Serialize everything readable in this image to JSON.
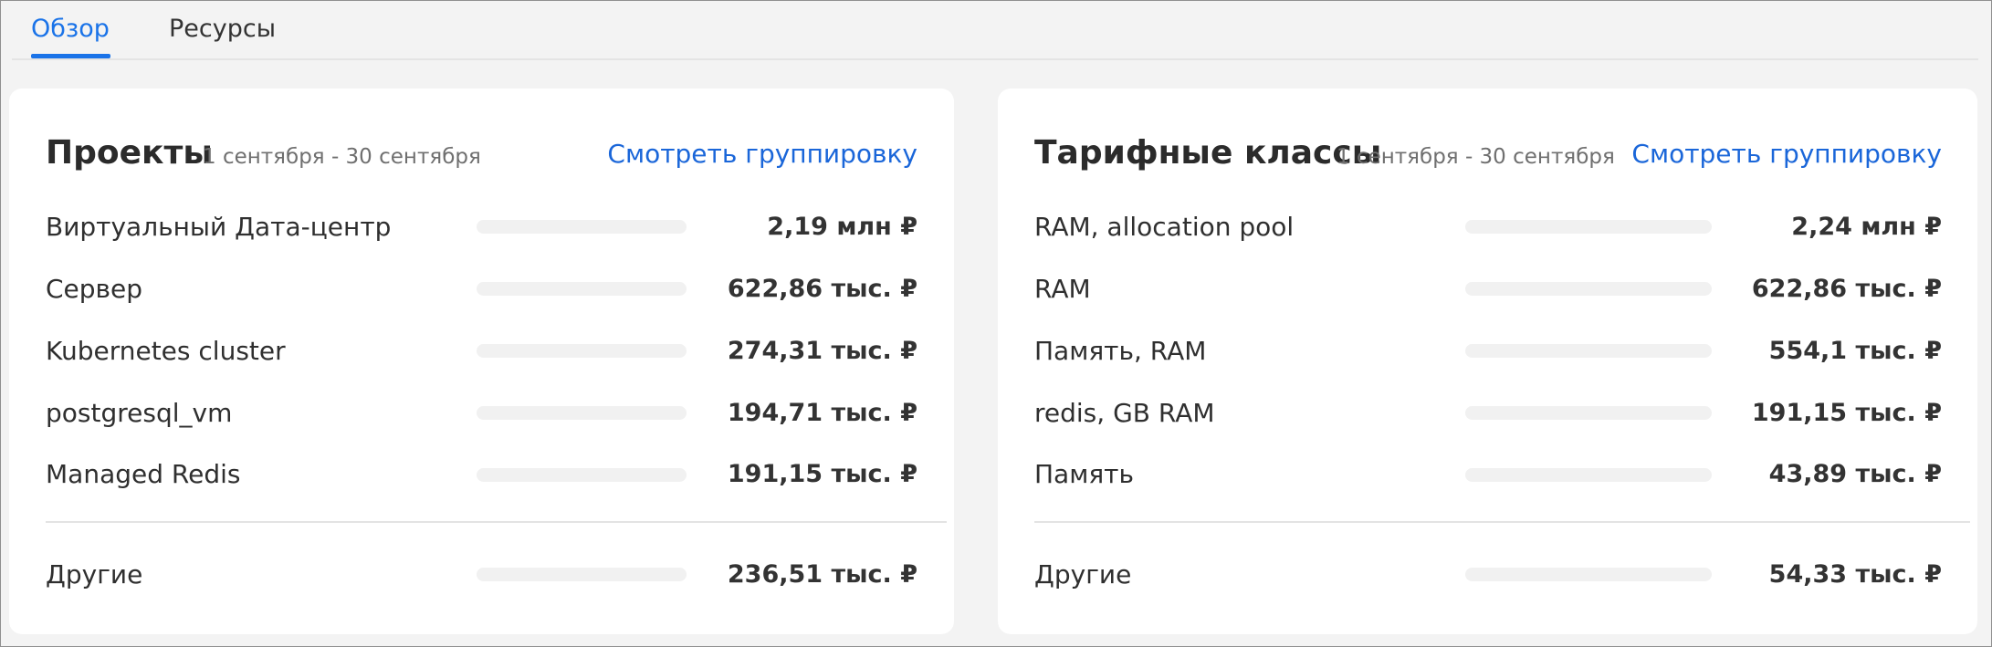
{
  "tabs": [
    {
      "label": "Обзор",
      "active": true
    },
    {
      "label": "Ресурсы",
      "active": false
    }
  ],
  "colors": {
    "accent": "#1a73e8",
    "link": "#1a66d9",
    "card_background": "#ffffff",
    "page_background": "#f3f3f3"
  },
  "projects_card": {
    "title": "Проекты",
    "period": "1 сентября - 30 сентября",
    "link_label": "Смотреть группировку",
    "rows": [
      {
        "label": "Виртуальный Дата-центр",
        "value": "2,19 млн ₽"
      },
      {
        "label": "Сервер",
        "value": "622,86 тыс. ₽"
      },
      {
        "label": "Kubernetes cluster",
        "value": "274,31 тыс. ₽"
      },
      {
        "label": "postgresql_vm",
        "value": "194,71 тыс. ₽"
      },
      {
        "label": "Managed Redis",
        "value": "191,15 тыс. ₽"
      }
    ],
    "other": {
      "label": "Другие",
      "value": "236,51 тыс. ₽"
    }
  },
  "tariff_card": {
    "title": "Тарифные классы",
    "period": "1 сентября - 30 сентября",
    "link_label": "Смотреть группировку",
    "rows": [
      {
        "label": "RAM, allocation pool",
        "value": "2,24 млн ₽"
      },
      {
        "label": "RAM",
        "value": "622,86 тыс. ₽"
      },
      {
        "label": "Память, RAM",
        "value": "554,1 тыс. ₽"
      },
      {
        "label": "redis, GB RAM",
        "value": "191,15 тыс. ₽"
      },
      {
        "label": "Память",
        "value": "43,89 тыс. ₽"
      }
    ],
    "other": {
      "label": "Другие",
      "value": "54,33 тыс. ₽"
    }
  }
}
